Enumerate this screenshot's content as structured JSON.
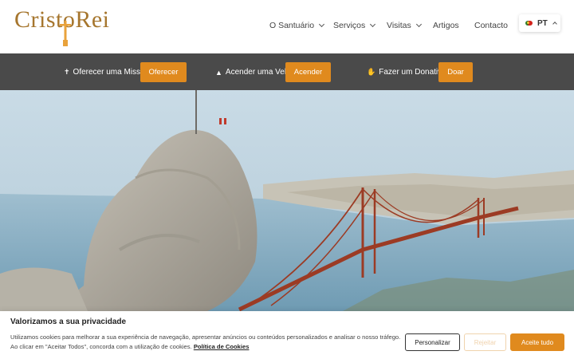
{
  "brand": {
    "logo_text": "CristoRei",
    "logo_color": "#a6762e"
  },
  "nav": {
    "items": [
      {
        "label": "O Santuário",
        "has_dropdown": true
      },
      {
        "label": "Serviços",
        "has_dropdown": true
      },
      {
        "label": "Visitas",
        "has_dropdown": true
      },
      {
        "label": "Artigos",
        "has_dropdown": false
      },
      {
        "label": "Contacto",
        "has_dropdown": false
      }
    ],
    "language": {
      "code": "PT",
      "flag_icon": "portugal-flag-icon"
    }
  },
  "actions": [
    {
      "icon": "cross-icon",
      "label": "Oferecer uma Missa",
      "button": "Oferecer"
    },
    {
      "icon": "candle-icon",
      "label": "Acender uma Vela",
      "button": "Acender"
    },
    {
      "icon": "donation-hand-icon",
      "label": "Fazer um Donativo",
      "button": "Doar"
    }
  ],
  "hero": {
    "image_description_icon": "statue-and-bridge-image"
  },
  "cookie": {
    "title": "Valorizamos a sua privacidade",
    "text": "Utilizamos cookies para melhorar a sua experiência de navegação, apresentar anúncios ou conteúdos personalizados e analisar o nosso tráfego. Ao clicar em \"Aceitar Todos\", concorda com a utilização de cookies.",
    "policy_link": "Política de Cookies",
    "buttons": {
      "customize": "Personalizar",
      "reject": "Rejeitar",
      "accept": "Aceite tudo"
    }
  },
  "colors": {
    "accent": "#e08a1e",
    "action_bar_bg": "#4a4a4a"
  }
}
